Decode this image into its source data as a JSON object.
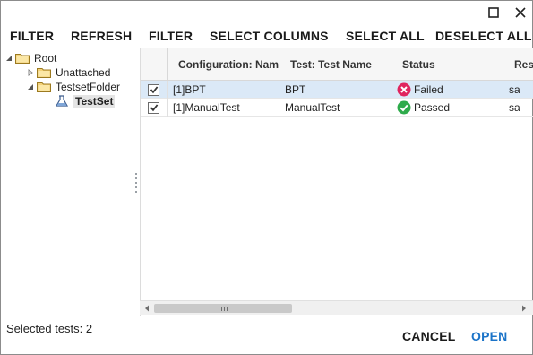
{
  "toolbar": {
    "filter_left": "FILTER",
    "refresh": "REFRESH",
    "filter": "FILTER",
    "select_columns": "SELECT COLUMNS",
    "select_all": "SELECT ALL",
    "deselect_all": "DESELECT ALL"
  },
  "tree": {
    "root": "Root",
    "unattached": "Unattached",
    "testset_folder": "TestsetFolder",
    "testset": "TestSet"
  },
  "grid": {
    "columns": [
      "Configuration: Name",
      "Test: Test Name",
      "Status",
      "Resp"
    ],
    "rows": [
      {
        "checked": true,
        "configuration": "[1]BPT",
        "test_name": "BPT",
        "status": "Failed",
        "responsible": "sa"
      },
      {
        "checked": true,
        "configuration": "[1]ManualTest",
        "test_name": "ManualTest",
        "status": "Passed",
        "responsible": "sa"
      }
    ]
  },
  "status_bar": {
    "selected_tests": "Selected tests: 2"
  },
  "footer": {
    "cancel": "CANCEL",
    "open": "OPEN"
  },
  "colors": {
    "accent": "#1a73c8",
    "failed": "#e0245e",
    "passed": "#2eab4b",
    "row_selected": "#dbe9f7"
  },
  "icons": [
    "maximize-icon",
    "close-icon",
    "folder-icon",
    "testset-icon",
    "failed-icon",
    "passed-icon",
    "checkbox-checked-icon"
  ]
}
